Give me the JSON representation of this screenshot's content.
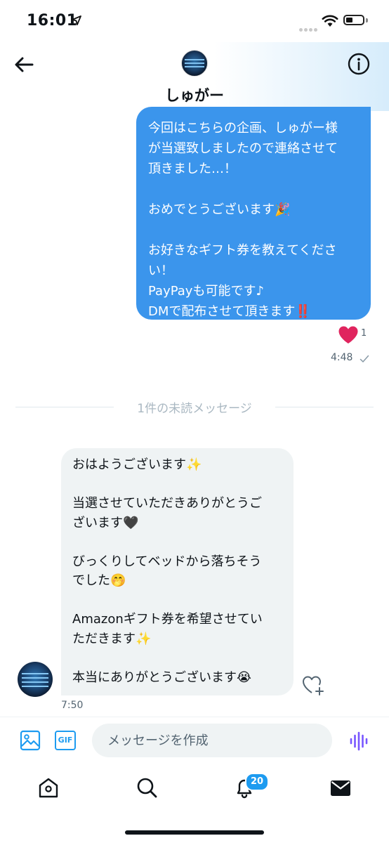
{
  "status_bar": {
    "time": "16:01"
  },
  "header": {
    "contact_name": "しゅがー"
  },
  "messages": {
    "sent": {
      "lines": [
        "今回はこちらの企画、しゅがー様",
        "が当選致しましたので連絡させて",
        "頂きました…！",
        "",
        "おめでとうございます🎉",
        "",
        "お好きなギフト券を教えてくださ",
        "い！",
        "PayPayも可能です♪",
        "DMで配布させて頂きます‼️"
      ],
      "like_count": "1",
      "time": "4:48"
    },
    "unread_divider": "1件の未読メッセージ",
    "received": {
      "lines": [
        "おはようございます✨",
        "",
        "当選させていただきありがとうご",
        "ざいます🖤",
        "",
        "びっくりしてベッドから落ちそう",
        "でした🤭",
        "",
        "Amazonギフト券を希望させてい",
        "ただきます✨",
        "",
        "本当にありがとうございます😭"
      ],
      "time": "7:50"
    }
  },
  "composer": {
    "gif_label": "GIF",
    "placeholder": "メッセージを作成"
  },
  "tab_bar": {
    "notifications_badge": "20"
  },
  "colors": {
    "accent": "#1d9bf0",
    "sent_bubble": "#3b95ec",
    "received_bubble": "#eff3f4",
    "like_red": "#f91880",
    "voice_purple": "#7856ff"
  },
  "icons": [
    "back-arrow-icon",
    "info-icon",
    "heart-icon",
    "check-icon",
    "image-icon",
    "gif-icon",
    "voice-icon",
    "home-icon",
    "search-icon",
    "bell-icon",
    "mail-icon",
    "heart-plus-icon"
  ]
}
